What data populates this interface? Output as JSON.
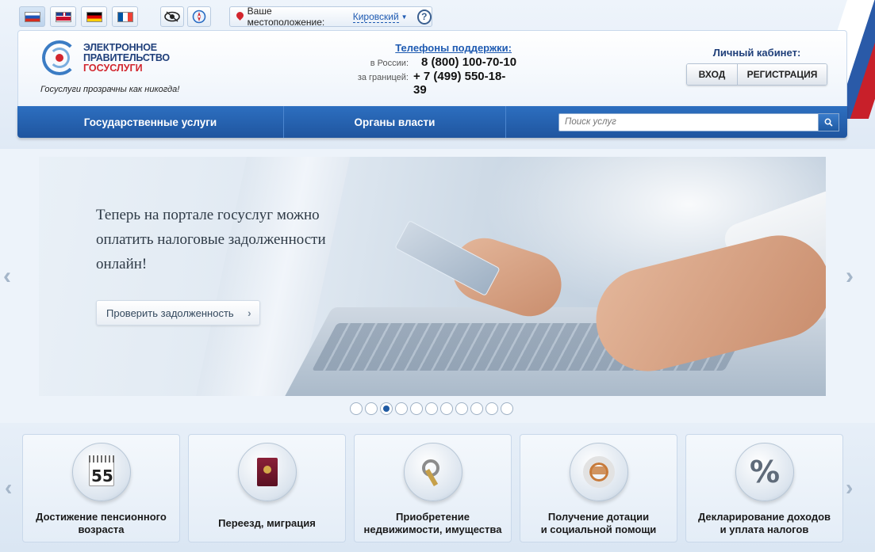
{
  "languages": [
    {
      "code": "ru",
      "icon": "flag-russia-icon"
    },
    {
      "code": "en",
      "icon": "flag-uk-icon"
    },
    {
      "code": "de",
      "icon": "flag-germany-icon"
    },
    {
      "code": "fr",
      "icon": "flag-france-icon"
    }
  ],
  "location": {
    "label": "Ваше местоположение:",
    "city": "Кировский"
  },
  "logo": {
    "line1": "ЭЛЕКТРОННОЕ",
    "line2": "ПРАВИТЕЛЬСТВО",
    "line3": "ГОСУСЛУГИ",
    "slogan": "Госуслуги прозрачны как никогда!"
  },
  "support": {
    "title": "Телефоны поддержки",
    "russia_label": "в России:",
    "russia_number": "8 (800) 100-70-10",
    "abroad_label": "за границей:",
    "abroad_number": "+ 7 (499) 550-18-39"
  },
  "cabinet": {
    "title": "Личный кабинет:",
    "login": "ВХОД",
    "register": "РЕГИСТРАЦИЯ"
  },
  "nav": {
    "services": "Государственные услуги",
    "authorities": "Органы власти",
    "search_placeholder": "Поиск услуг"
  },
  "banner": {
    "text": "Теперь на портале госуслуг можно оплатить налоговые задолженности онлайн!",
    "button": "Проверить задолженность",
    "total_slides": 11,
    "active_slide": 3
  },
  "tiles": [
    {
      "line1": "Достижение пенсионного",
      "line2": "возраста",
      "icon": "calendar-icon",
      "icon_text": "55"
    },
    {
      "line1": "Переезд, миграция",
      "line2": "",
      "icon": "passport-icon"
    },
    {
      "line1": "Приобретение",
      "line2": "недвижимости, имущества",
      "icon": "keys-icon"
    },
    {
      "line1": "Получение дотации",
      "line2": "и социальной помощи",
      "icon": "lifebuoy-icon"
    },
    {
      "line1": "Декларирование доходов",
      "line2": "и уплата налогов",
      "icon": "percent-icon",
      "icon_text": "%"
    }
  ],
  "colors": {
    "brand_blue": "#1f559f",
    "brand_red": "#d2262e"
  }
}
